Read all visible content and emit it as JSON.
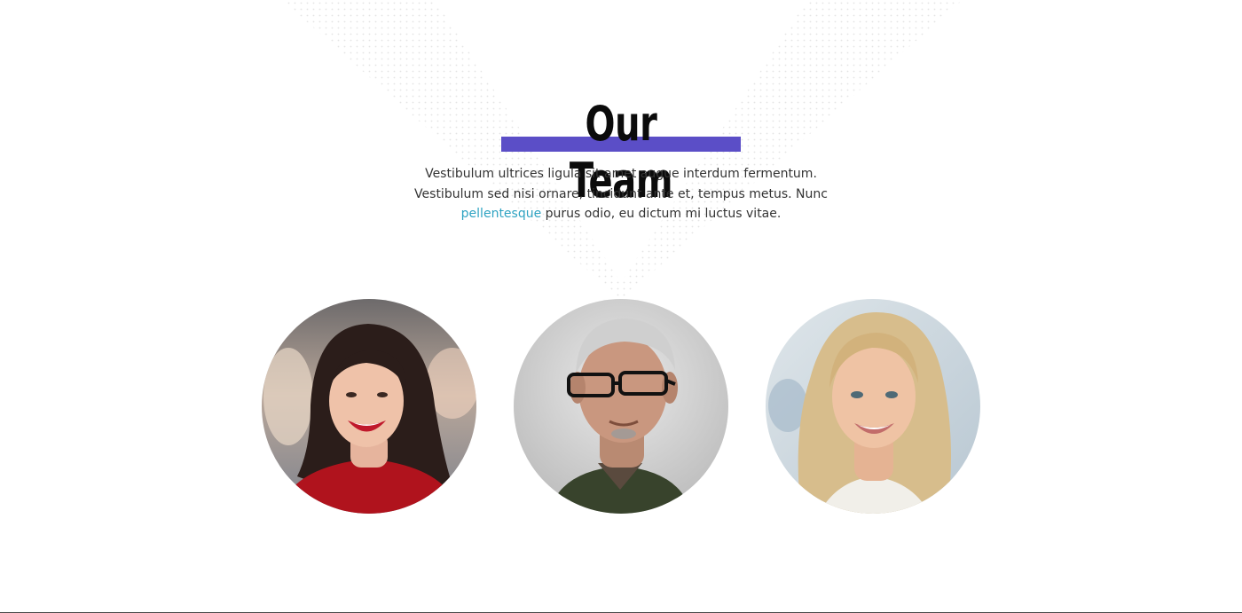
{
  "section": {
    "heading": "Our Team",
    "intro_before_link": "Vestibulum ultrices ligula sit amet augue interdum fermentum. Vestibulum sed nisi ornare, tincidunt ante et, tempus metus. Nunc ",
    "intro_link": "pellentesque",
    "intro_after_link": " purus odio, eu dictum mi luctus vitae."
  },
  "team": [
    {
      "photo": "portrait-woman-red-sweater"
    },
    {
      "photo": "portrait-man-glasses"
    },
    {
      "photo": "portrait-woman-blonde"
    }
  ],
  "colors": {
    "accent": "#5b4ec7",
    "link": "#2ea3c2",
    "heading": "#0b0b0b",
    "body_text": "#333333",
    "dot_pattern": "#e4e4e4"
  }
}
